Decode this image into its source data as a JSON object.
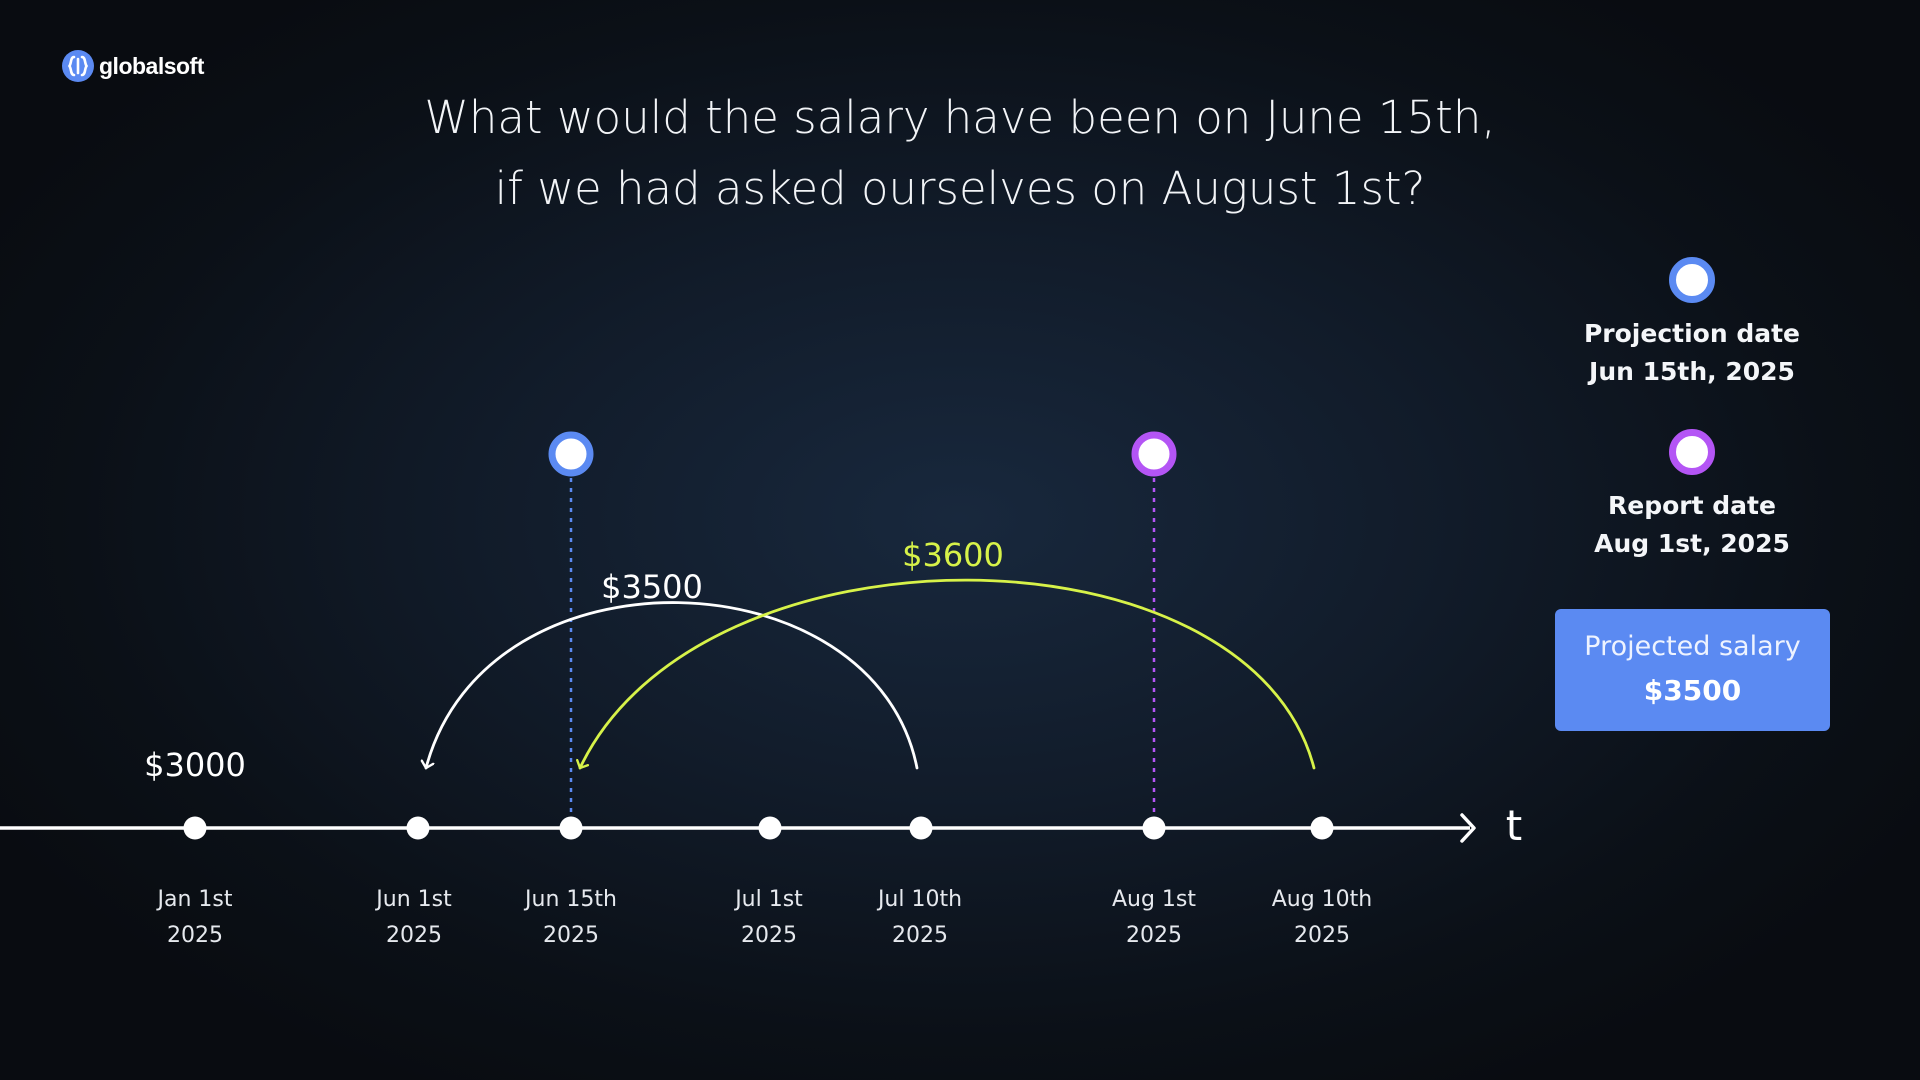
{
  "brand": {
    "name": "globalsoft",
    "icon": "globalsoft-logo-icon",
    "color": "#5b8af2"
  },
  "headline": {
    "line1": "What would the salary have been on June 15th,",
    "line2": "if we had asked ourselves on August 1st?"
  },
  "timeline": {
    "axis_label": "t",
    "axis_color": "#ffffff",
    "ticks": [
      {
        "id": "jan-1",
        "date": "2025-01-01",
        "label_line1": "Jan 1st",
        "label_line2": "2025"
      },
      {
        "id": "jun-1",
        "date": "2025-06-01",
        "label_line1": "Jun 1st",
        "label_line2": "2025"
      },
      {
        "id": "jun-15",
        "date": "2025-06-15",
        "label_line1": "Jun 15th",
        "label_line2": "2025"
      },
      {
        "id": "jul-1",
        "date": "2025-07-01",
        "label_line1": "Jul 1st",
        "label_line2": "2025"
      },
      {
        "id": "jul-10",
        "date": "2025-07-10",
        "label_line1": "Jul 10th",
        "label_line2": "2025"
      },
      {
        "id": "aug-1",
        "date": "2025-08-01",
        "label_line1": "Aug 1st",
        "label_line2": "2025"
      },
      {
        "id": "aug-10",
        "date": "2025-08-10",
        "label_line1": "Aug 10th",
        "label_line2": "2025"
      }
    ],
    "markers": [
      {
        "id": "projection",
        "date": "2025-06-15",
        "color": "#5b8af2"
      },
      {
        "id": "report",
        "date": "2025-08-01",
        "color": "#b455f5"
      }
    ],
    "salary_values": [
      {
        "id": "jan-salary",
        "date": "2025-01-01",
        "label": "$3000",
        "color": "#ffffff"
      }
    ],
    "arcs": [
      {
        "id": "arc-jul10-jun1",
        "from": "2025-07-10",
        "to": "2025-06-01",
        "label": "$3500",
        "color": "#ffffff"
      },
      {
        "id": "arc-aug10-jun15",
        "from": "2025-08-10",
        "to": "2025-06-15",
        "label": "$3600",
        "color": "#d7f249"
      }
    ]
  },
  "legend": {
    "projection": {
      "title": "Projection date",
      "date": "Jun 15th, 2025",
      "color": "#5b8af2"
    },
    "report": {
      "title": "Report date",
      "date": "Aug 1st, 2025",
      "color": "#b455f5"
    }
  },
  "result": {
    "label": "Projected salary",
    "value": "$3500",
    "background": "#5b8af2"
  }
}
